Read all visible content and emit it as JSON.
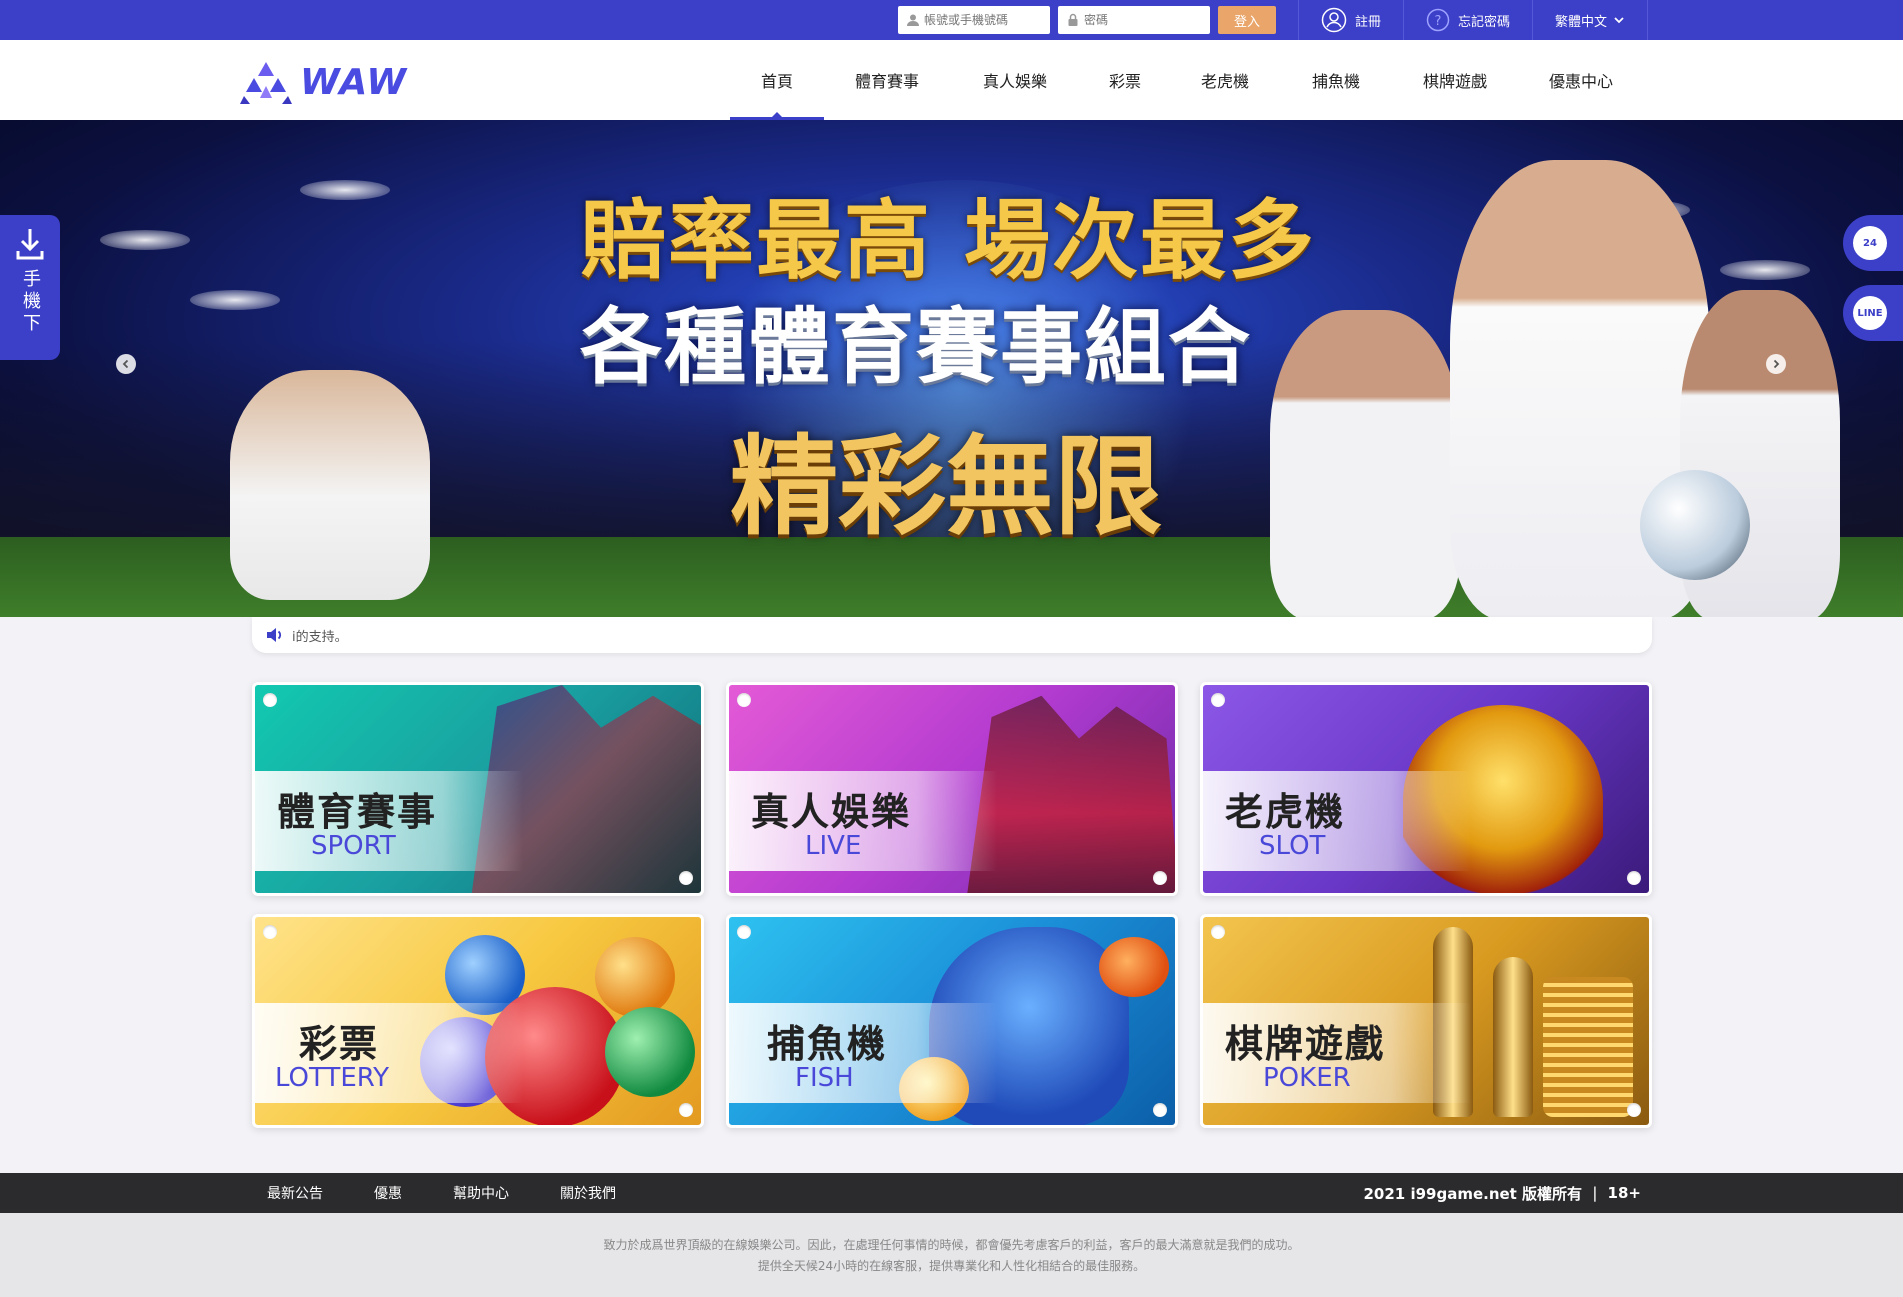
{
  "topbar": {
    "account_placeholder": "帳號或手機號碼",
    "password_placeholder": "密碼",
    "login_label": "登入",
    "register_label": "註冊",
    "forgot_label": "忘記密碼",
    "language_label": "繁體中文"
  },
  "header": {
    "logo_text": "WAW",
    "nav": [
      {
        "label": "首頁",
        "active": true
      },
      {
        "label": "體育賽事"
      },
      {
        "label": "真人娛樂"
      },
      {
        "label": "彩票"
      },
      {
        "label": "老虎機"
      },
      {
        "label": "捕魚機"
      },
      {
        "label": "棋牌遊戲"
      },
      {
        "label": "優惠中心"
      }
    ]
  },
  "banner": {
    "line1": "賠率最高 場次最多",
    "line2": "各種體育賽事組合",
    "line3": "精彩無限",
    "prev_icon": "chevron-left-icon",
    "next_icon": "chevron-right-icon"
  },
  "side": {
    "download_label": "手機下",
    "support_badge": "24",
    "line_badge": "LINE"
  },
  "marquee": {
    "text": "i的支持。"
  },
  "cards": [
    {
      "zh": "體育賽事",
      "en": "SPORT"
    },
    {
      "zh": "真人娛樂",
      "en": "LIVE"
    },
    {
      "zh": "老虎機",
      "en": "SLOT"
    },
    {
      "zh": "彩票",
      "en": "LOTTERY"
    },
    {
      "zh": "捕魚機",
      "en": "FISH"
    },
    {
      "zh": "棋牌遊戲",
      "en": "POKER"
    }
  ],
  "footer": {
    "links": [
      "最新公告",
      "優惠",
      "幫助中心",
      "關於我們"
    ],
    "copyright": "2021 i99game.net 版權所有",
    "age": "18+",
    "line1": "致力於成爲世界頂級的在線娛樂公司。因此，在處理任何事情的時候，都會優先考慮客戶的利益，客戶的最大滿意就是我們的成功。",
    "line2": "提供全天候24小時的在線客服，提供專業化和人性化相結合的最佳服務。"
  },
  "colors": {
    "brand": "#3c3fc7",
    "login_button": "#e9a56a",
    "footer": "#2b2b2e"
  }
}
